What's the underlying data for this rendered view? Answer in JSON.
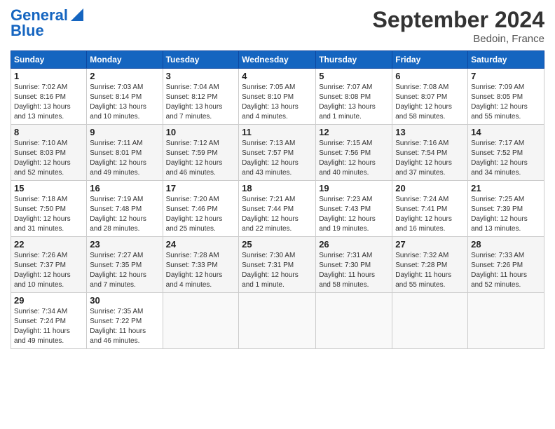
{
  "logo": {
    "line1": "General",
    "line2": "Blue"
  },
  "header": {
    "month": "September 2024",
    "location": "Bedoin, France"
  },
  "weekdays": [
    "Sunday",
    "Monday",
    "Tuesday",
    "Wednesday",
    "Thursday",
    "Friday",
    "Saturday"
  ],
  "weeks": [
    [
      {
        "day": "1",
        "info": "Sunrise: 7:02 AM\nSunset: 8:16 PM\nDaylight: 13 hours\nand 13 minutes."
      },
      {
        "day": "2",
        "info": "Sunrise: 7:03 AM\nSunset: 8:14 PM\nDaylight: 13 hours\nand 10 minutes."
      },
      {
        "day": "3",
        "info": "Sunrise: 7:04 AM\nSunset: 8:12 PM\nDaylight: 13 hours\nand 7 minutes."
      },
      {
        "day": "4",
        "info": "Sunrise: 7:05 AM\nSunset: 8:10 PM\nDaylight: 13 hours\nand 4 minutes."
      },
      {
        "day": "5",
        "info": "Sunrise: 7:07 AM\nSunset: 8:08 PM\nDaylight: 13 hours\nand 1 minute."
      },
      {
        "day": "6",
        "info": "Sunrise: 7:08 AM\nSunset: 8:07 PM\nDaylight: 12 hours\nand 58 minutes."
      },
      {
        "day": "7",
        "info": "Sunrise: 7:09 AM\nSunset: 8:05 PM\nDaylight: 12 hours\nand 55 minutes."
      }
    ],
    [
      {
        "day": "8",
        "info": "Sunrise: 7:10 AM\nSunset: 8:03 PM\nDaylight: 12 hours\nand 52 minutes."
      },
      {
        "day": "9",
        "info": "Sunrise: 7:11 AM\nSunset: 8:01 PM\nDaylight: 12 hours\nand 49 minutes."
      },
      {
        "day": "10",
        "info": "Sunrise: 7:12 AM\nSunset: 7:59 PM\nDaylight: 12 hours\nand 46 minutes."
      },
      {
        "day": "11",
        "info": "Sunrise: 7:13 AM\nSunset: 7:57 PM\nDaylight: 12 hours\nand 43 minutes."
      },
      {
        "day": "12",
        "info": "Sunrise: 7:15 AM\nSunset: 7:56 PM\nDaylight: 12 hours\nand 40 minutes."
      },
      {
        "day": "13",
        "info": "Sunrise: 7:16 AM\nSunset: 7:54 PM\nDaylight: 12 hours\nand 37 minutes."
      },
      {
        "day": "14",
        "info": "Sunrise: 7:17 AM\nSunset: 7:52 PM\nDaylight: 12 hours\nand 34 minutes."
      }
    ],
    [
      {
        "day": "15",
        "info": "Sunrise: 7:18 AM\nSunset: 7:50 PM\nDaylight: 12 hours\nand 31 minutes."
      },
      {
        "day": "16",
        "info": "Sunrise: 7:19 AM\nSunset: 7:48 PM\nDaylight: 12 hours\nand 28 minutes."
      },
      {
        "day": "17",
        "info": "Sunrise: 7:20 AM\nSunset: 7:46 PM\nDaylight: 12 hours\nand 25 minutes."
      },
      {
        "day": "18",
        "info": "Sunrise: 7:21 AM\nSunset: 7:44 PM\nDaylight: 12 hours\nand 22 minutes."
      },
      {
        "day": "19",
        "info": "Sunrise: 7:23 AM\nSunset: 7:43 PM\nDaylight: 12 hours\nand 19 minutes."
      },
      {
        "day": "20",
        "info": "Sunrise: 7:24 AM\nSunset: 7:41 PM\nDaylight: 12 hours\nand 16 minutes."
      },
      {
        "day": "21",
        "info": "Sunrise: 7:25 AM\nSunset: 7:39 PM\nDaylight: 12 hours\nand 13 minutes."
      }
    ],
    [
      {
        "day": "22",
        "info": "Sunrise: 7:26 AM\nSunset: 7:37 PM\nDaylight: 12 hours\nand 10 minutes."
      },
      {
        "day": "23",
        "info": "Sunrise: 7:27 AM\nSunset: 7:35 PM\nDaylight: 12 hours\nand 7 minutes."
      },
      {
        "day": "24",
        "info": "Sunrise: 7:28 AM\nSunset: 7:33 PM\nDaylight: 12 hours\nand 4 minutes."
      },
      {
        "day": "25",
        "info": "Sunrise: 7:30 AM\nSunset: 7:31 PM\nDaylight: 12 hours\nand 1 minute."
      },
      {
        "day": "26",
        "info": "Sunrise: 7:31 AM\nSunset: 7:30 PM\nDaylight: 11 hours\nand 58 minutes."
      },
      {
        "day": "27",
        "info": "Sunrise: 7:32 AM\nSunset: 7:28 PM\nDaylight: 11 hours\nand 55 minutes."
      },
      {
        "day": "28",
        "info": "Sunrise: 7:33 AM\nSunset: 7:26 PM\nDaylight: 11 hours\nand 52 minutes."
      }
    ],
    [
      {
        "day": "29",
        "info": "Sunrise: 7:34 AM\nSunset: 7:24 PM\nDaylight: 11 hours\nand 49 minutes."
      },
      {
        "day": "30",
        "info": "Sunrise: 7:35 AM\nSunset: 7:22 PM\nDaylight: 11 hours\nand 46 minutes."
      },
      {
        "day": "",
        "info": ""
      },
      {
        "day": "",
        "info": ""
      },
      {
        "day": "",
        "info": ""
      },
      {
        "day": "",
        "info": ""
      },
      {
        "day": "",
        "info": ""
      }
    ]
  ]
}
